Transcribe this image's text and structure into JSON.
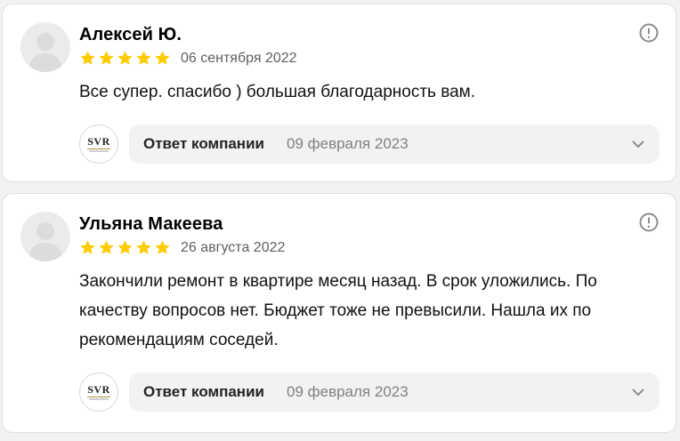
{
  "colors": {
    "star": "#fc0",
    "card_border": "#dedede",
    "page_bg": "#f2f2f2",
    "muted_text": "#808080",
    "icon": "#8c8c8c"
  },
  "reviews": [
    {
      "author": "Алексей Ю.",
      "rating": 5,
      "date": "06 сентября 2022",
      "text": "Все супер. спасибо ) большая благодарность вам.",
      "company_response": {
        "logo_text": "SVR",
        "label": "Ответ компании",
        "date": "09 февраля 2023",
        "expanded": false
      },
      "icons": {
        "avatar": "user-placeholder-icon",
        "report": "exclamation-circle-icon",
        "expand": "chevron-down-icon"
      }
    },
    {
      "author": "Ульяна Макеева",
      "rating": 5,
      "date": "26 августа 2022",
      "text": "Закончили ремонт в квартире месяц назад. В срок уложились. По качеству вопросов нет. Бюджет тоже не превысили. Нашла их по рекомендациям соседей.",
      "company_response": {
        "logo_text": "SVR",
        "label": "Ответ компании",
        "date": "09 февраля 2023",
        "expanded": false
      },
      "icons": {
        "avatar": "user-placeholder-icon",
        "report": "exclamation-circle-icon",
        "expand": "chevron-down-icon"
      }
    }
  ]
}
